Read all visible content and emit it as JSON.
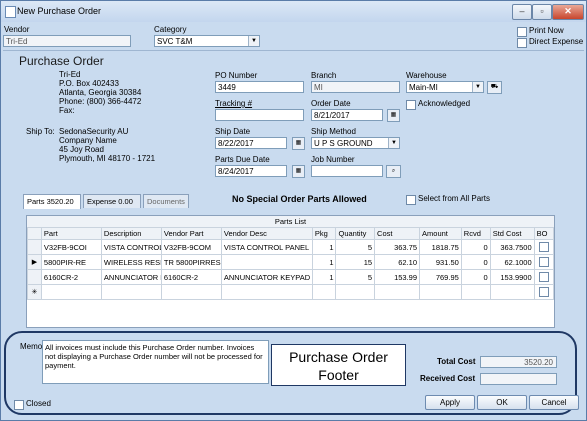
{
  "window": {
    "title": "New Purchase Order"
  },
  "vendor": {
    "label": "Vendor",
    "value": "Tri-Ed"
  },
  "category": {
    "label": "Category",
    "value": "SVC T&M"
  },
  "print_now": {
    "label": "Print Now"
  },
  "direct_expense": {
    "label": "Direct Expense"
  },
  "section_title": "Purchase Order",
  "vendor_address": [
    "Tri-Ed",
    "P.O. Box 402433",
    "Atlanta, Georgia  30384",
    "Phone: (800) 366-4472",
    "Fax:"
  ],
  "ship_to": {
    "label": "Ship To:",
    "lines": [
      "SedonaSecurity AU",
      "Company Name",
      "45 Joy Road",
      "Plymouth, MI  48170 - 1721"
    ]
  },
  "po_number": {
    "label": "PO Number",
    "value": "3449"
  },
  "branch": {
    "label": "Branch",
    "value": "MI"
  },
  "warehouse": {
    "label": "Warehouse",
    "value": "Main-MI"
  },
  "tracking": {
    "label": "Tracking #",
    "value": ""
  },
  "order_date": {
    "label": "Order Date",
    "value": "8/21/2017"
  },
  "acknowledged": {
    "label": "Acknowledged"
  },
  "ship_date": {
    "label": "Ship Date",
    "value": "8/22/2017"
  },
  "ship_method": {
    "label": "Ship Method",
    "value": "U P S GROUND"
  },
  "parts_due_date": {
    "label": "Parts Due Date",
    "value": "8/24/2017"
  },
  "job_number": {
    "label": "Job Number",
    "value": ""
  },
  "tabs": [
    {
      "label": "Parts  3520.20"
    },
    {
      "label": "Expense  0.00"
    },
    {
      "label": "Documents"
    }
  ],
  "special_notice": "No Special Order Parts Allowed",
  "select_all_parts": {
    "label": "Select from All Parts"
  },
  "parts_list": {
    "title": "Parts List",
    "columns": [
      "Part",
      "Description",
      "Vendor Part",
      "Vendor Desc",
      "Pkg",
      "Quantity",
      "Cost",
      "Amount",
      "Rcvd",
      "Std Cost",
      "BO"
    ],
    "rows": [
      {
        "marker": "",
        "part": "V32FB-9COI",
        "description": "VISTA CONTROL PANEL",
        "vendor_part": "V32FB-9COM",
        "vendor_desc": "VISTA CONTROL PANEL",
        "pkg": "1",
        "quantity": "5",
        "cost": "363.75",
        "amount": "1818.75",
        "rcvd": "0",
        "std_cost": "363.7500"
      },
      {
        "marker": "▶",
        "part": "5800PIR-RE",
        "description": "WIRELESS RESIDENTIA",
        "vendor_part": "TR 5800PIRRES",
        "vendor_desc": "",
        "pkg": "1",
        "quantity": "15",
        "cost": "62.10",
        "amount": "931.50",
        "rcvd": "0",
        "std_cost": "62.1000"
      },
      {
        "marker": "",
        "part": "6160CR-2",
        "description": "ANNUNCIATOR KEYPAD",
        "vendor_part": "6160CR-2",
        "vendor_desc": "ANNUNCIATOR KEYPAD",
        "pkg": "1",
        "quantity": "5",
        "cost": "153.99",
        "amount": "769.95",
        "rcvd": "0",
        "std_cost": "153.9900"
      },
      {
        "marker": "✳",
        "part": "",
        "description": "",
        "vendor_part": "",
        "vendor_desc": "",
        "pkg": "",
        "quantity": "",
        "cost": "",
        "amount": "",
        "rcvd": "",
        "std_cost": ""
      }
    ]
  },
  "memo": {
    "label": "Memo",
    "value": "All invoices must include this Purchase Order number.  Invoices not displaying a Purchase Order number will not be processed for payment."
  },
  "callout": {
    "line1": "Purchase Order",
    "line2": "Footer"
  },
  "total_cost": {
    "label": "Total Cost",
    "value": "3520.20"
  },
  "received_cost": {
    "label": "Received Cost",
    "value": ""
  },
  "closed": {
    "label": "Closed"
  },
  "buttons": {
    "apply": "Apply",
    "ok": "OK",
    "cancel": "Cancel"
  }
}
